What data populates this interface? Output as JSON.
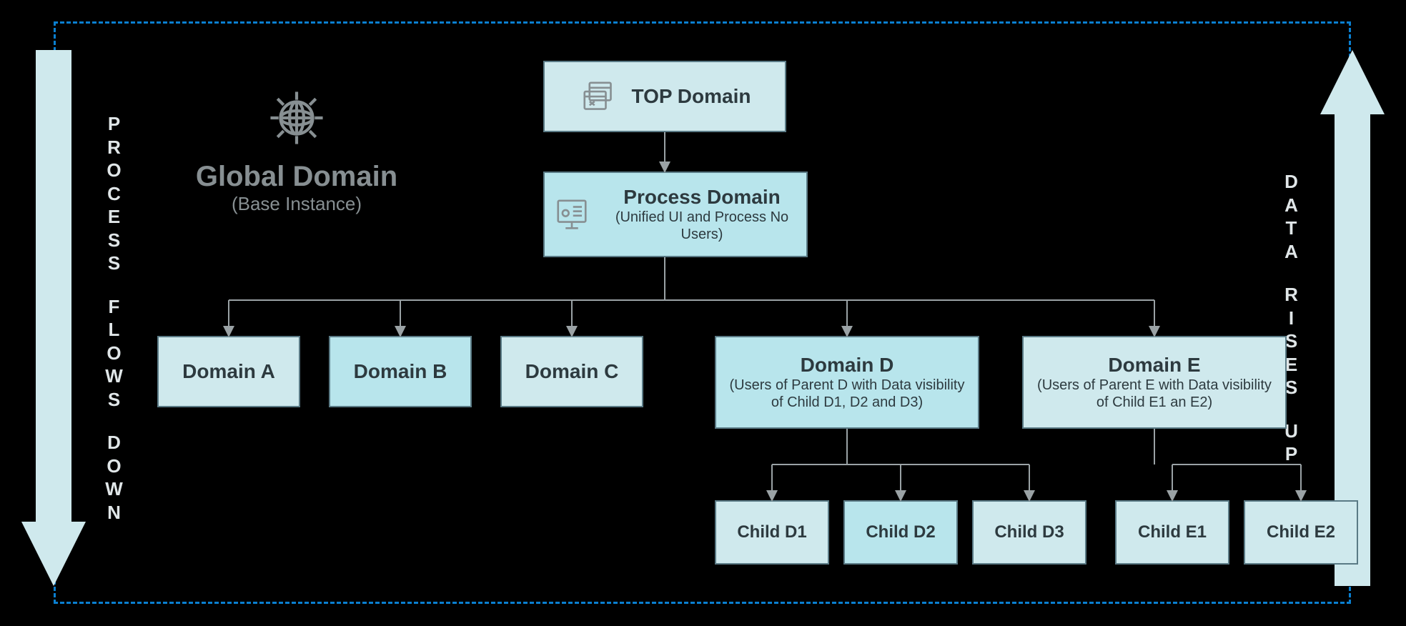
{
  "leftArrowLabel": [
    "PROCESS",
    "FLOWS",
    "DOWN"
  ],
  "rightArrowLabel": [
    "DATA",
    "RISES",
    "UP"
  ],
  "global": {
    "title": "Global Domain",
    "subtitle": "(Base Instance)"
  },
  "top": {
    "title": "TOP Domain"
  },
  "process": {
    "title": "Process Domain",
    "subtitle": "(Unified UI and Process No Users)"
  },
  "level1": {
    "a": {
      "title": "Domain A"
    },
    "b": {
      "title": "Domain B"
    },
    "c": {
      "title": "Domain C"
    },
    "d": {
      "title": "Domain D",
      "subtitle": "(Users of Parent D with Data visibility of Child D1, D2 and D3)"
    },
    "e": {
      "title": "Domain E",
      "subtitle": "(Users of Parent E with Data visibility of Child E1 an E2)"
    }
  },
  "level2": {
    "d1": {
      "title": "Child D1"
    },
    "d2": {
      "title": "Child D2"
    },
    "d3": {
      "title": "Child D3"
    },
    "e1": {
      "title": "Child E1"
    },
    "e2": {
      "title": "Child E2"
    }
  },
  "colors": {
    "arrow": "#cfe9ed",
    "dash": "#0a7fd0"
  }
}
